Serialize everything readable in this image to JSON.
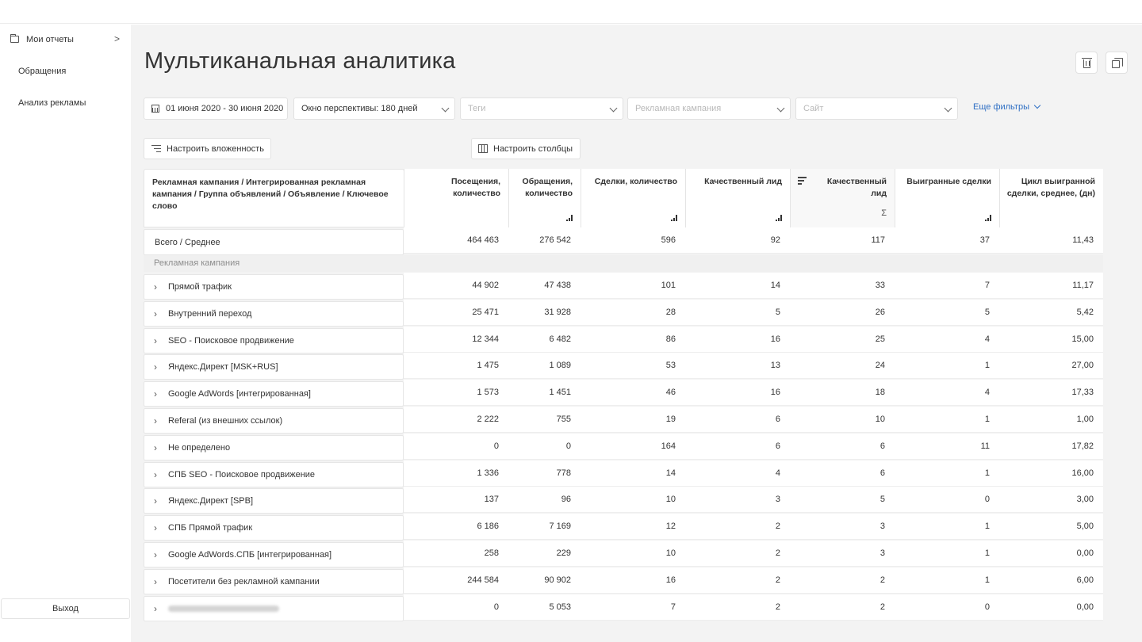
{
  "sidebar": {
    "items": [
      {
        "label": "Мои отчеты",
        "icon": "folder-icon",
        "chevron": ">"
      },
      {
        "label": "Обращения"
      },
      {
        "label": "Анализ рекламы"
      }
    ],
    "logout_label": "Выход"
  },
  "header": {
    "title": "Мультиканальная аналитика",
    "actions": [
      "trash-icon",
      "copy-icon"
    ]
  },
  "filters": {
    "date_range": "01 июня 2020 - 30 июня 2020",
    "window_label": "Окно перспективы:  180 дней",
    "tags_placeholder": "Теги",
    "campaign_placeholder": "Рекламная кампания",
    "site_placeholder": "Сайт",
    "more_filters": "Еще фильтры"
  },
  "toolbar": {
    "nesting_label": "Настроить вложенность",
    "columns_label": "Настроить столбцы"
  },
  "table": {
    "columns": [
      {
        "label": "Рекламная кампания / Интегрированная рекламная кампания / Группа объявлений / Объявление / Ключевое слово"
      },
      {
        "label": "Посещения, количество"
      },
      {
        "label": "Обращения, количество",
        "icon": "bar-chart-icon"
      },
      {
        "label": "Сделки, количество",
        "icon": "bar-chart-icon"
      },
      {
        "label": "Качественный лид",
        "icon": "bar-chart-icon"
      },
      {
        "label": "Качественный лид",
        "icon": "sigma-icon",
        "sorted": true
      },
      {
        "label": "Выигранные сделки",
        "icon": "bar-chart-icon"
      },
      {
        "label": "Цикл выигранной сделки, среднее, (дн)"
      }
    ],
    "total": {
      "label": "Всего / Среднее",
      "values": [
        "464 463",
        "276 542",
        "596",
        "92",
        "117",
        "37",
        "11,43"
      ]
    },
    "group_label": "Рекламная кампания",
    "rows": [
      {
        "name": "Прямой трафик",
        "values": [
          "44 902",
          "47 438",
          "101",
          "14",
          "33",
          "7",
          "11,17"
        ]
      },
      {
        "name": "Внутренний переход",
        "values": [
          "25 471",
          "31 928",
          "28",
          "5",
          "26",
          "5",
          "5,42"
        ]
      },
      {
        "name": "SEO - Поисковое продвижение",
        "values": [
          "12 344",
          "6 482",
          "86",
          "16",
          "25",
          "4",
          "15,00"
        ]
      },
      {
        "name": "Яндекс.Директ [MSK+RUS]",
        "values": [
          "1 475",
          "1 089",
          "53",
          "13",
          "24",
          "1",
          "27,00"
        ]
      },
      {
        "name": "Google AdWords [интегрированная]",
        "values": [
          "1 573",
          "1 451",
          "46",
          "16",
          "18",
          "4",
          "17,33"
        ]
      },
      {
        "name": "Referal (из внешних ссылок)",
        "values": [
          "2 222",
          "755",
          "19",
          "6",
          "10",
          "1",
          "1,00"
        ]
      },
      {
        "name": "Не определено",
        "values": [
          "0",
          "0",
          "164",
          "6",
          "6",
          "11",
          "17,82"
        ]
      },
      {
        "name": "СПБ SEO - Поисковое продвижение",
        "values": [
          "1 336",
          "778",
          "14",
          "4",
          "6",
          "1",
          "16,00"
        ]
      },
      {
        "name": "Яндекс.Директ [SPB]",
        "values": [
          "137",
          "96",
          "10",
          "3",
          "5",
          "0",
          "3,00"
        ]
      },
      {
        "name": "СПБ Прямой трафик",
        "values": [
          "6 186",
          "7 169",
          "12",
          "2",
          "3",
          "1",
          "5,00"
        ]
      },
      {
        "name": "Google AdWords.СПБ [интегрированная]",
        "values": [
          "258",
          "229",
          "10",
          "2",
          "3",
          "1",
          "0,00"
        ]
      },
      {
        "name": "Посетители без рекламной кампании",
        "values": [
          "244 584",
          "90 902",
          "16",
          "2",
          "2",
          "1",
          "6,00"
        ]
      },
      {
        "name": "",
        "blurred": true,
        "values": [
          "0",
          "5 053",
          "7",
          "2",
          "2",
          "0",
          "0,00"
        ]
      }
    ]
  },
  "colors": {
    "accent": "#2f6fc4",
    "background": "#f3f3f3",
    "panel": "#ffffff",
    "muted_text": "#8d8d8d"
  }
}
